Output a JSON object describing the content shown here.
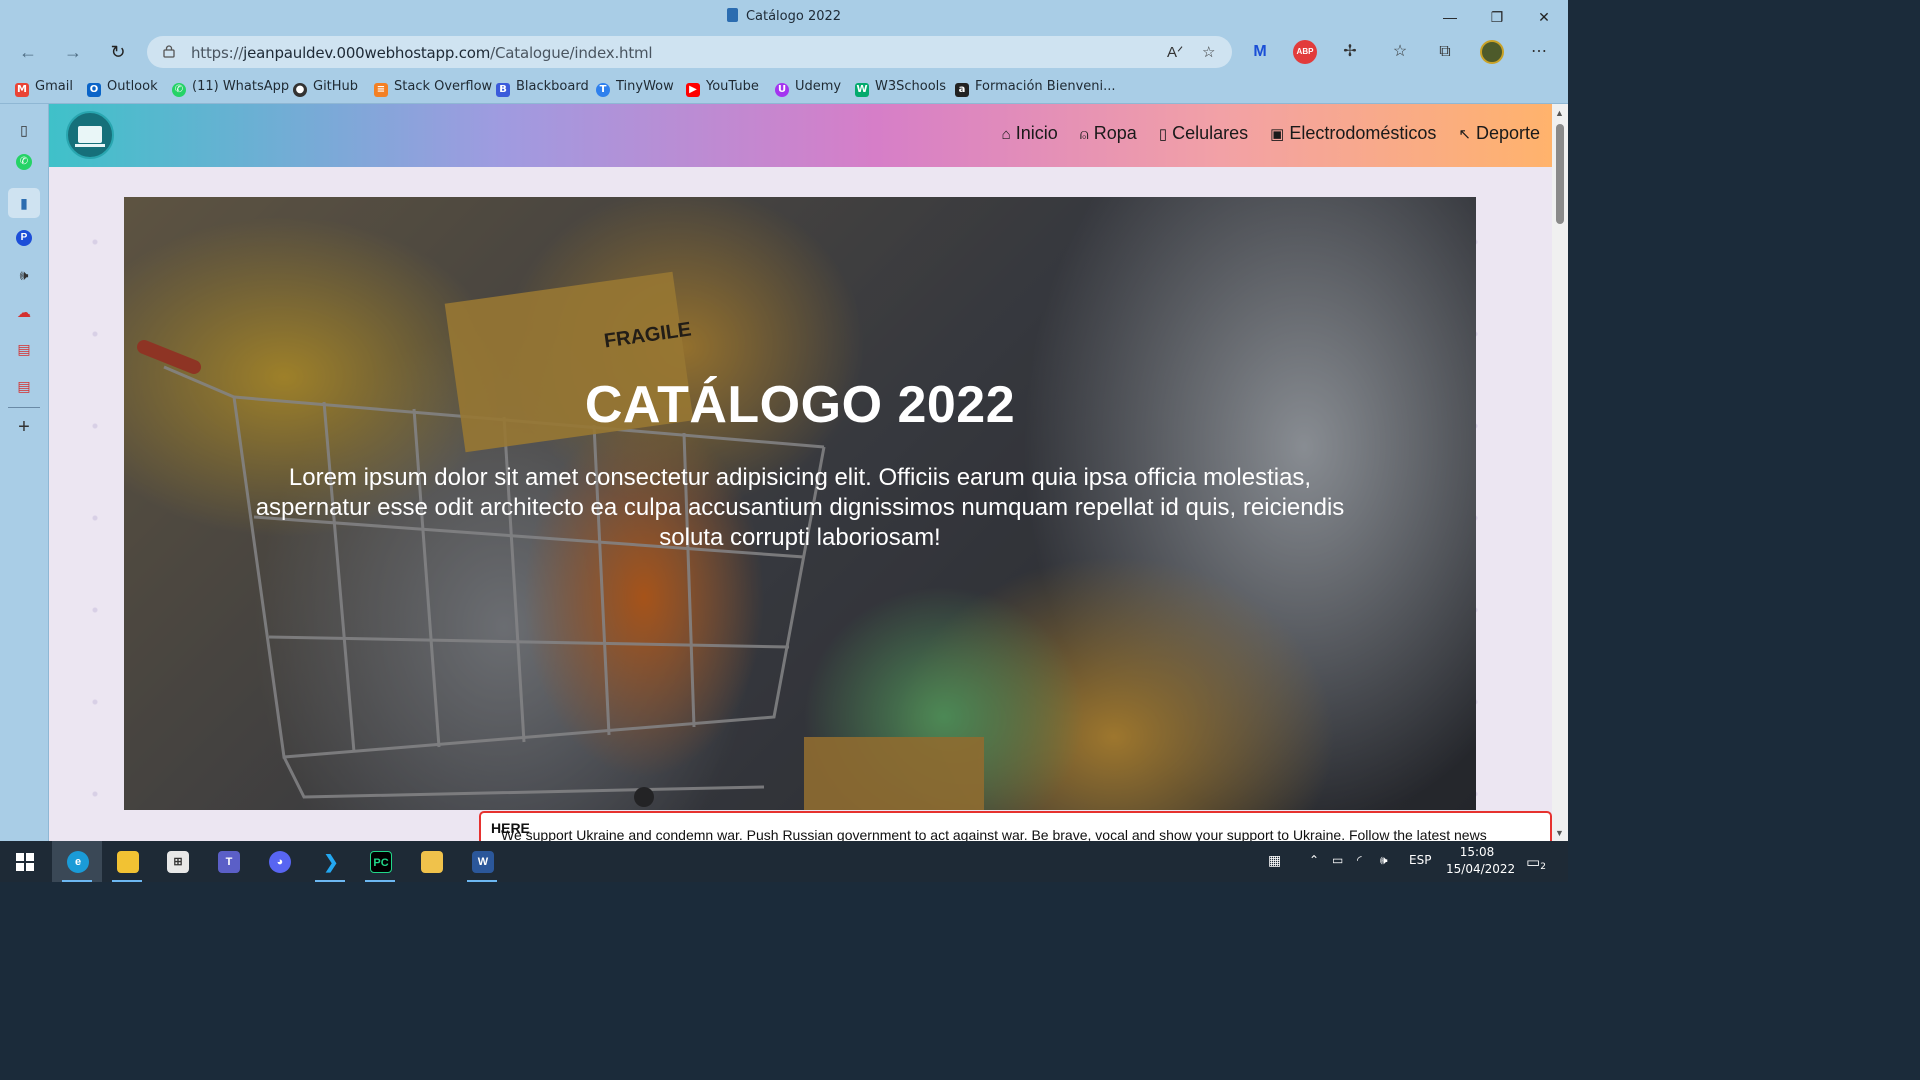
{
  "browser": {
    "tab_title": "Catálogo 2022",
    "url_prefix": "https://",
    "url_domain": "jeanpauldev.000webhostapp.com",
    "url_path": "/Catalogue/index.html",
    "window_controls": [
      "minimize-icon",
      "restore-icon",
      "close-icon"
    ],
    "toolbar_icons": [
      "read-aloud-icon",
      "add-favorite-icon",
      "malwarebytes-icon",
      "adblock-plus-icon",
      "extensions-icon",
      "favorites-icon",
      "collections-icon",
      "profile-avatar",
      "more-icon"
    ],
    "adblock_label": "ABP"
  },
  "bookmarks": [
    {
      "label": "Gmail",
      "icon": "gmail-icon",
      "color": "#ea4335"
    },
    {
      "label": "Outlook",
      "icon": "outlook-icon",
      "color": "#0a64c8"
    },
    {
      "label": "(11) WhatsApp",
      "icon": "whatsapp-icon",
      "color": "#25d366"
    },
    {
      "label": "GitHub",
      "icon": "github-icon",
      "color": "#333333"
    },
    {
      "label": "Stack Overflow",
      "icon": "stackoverflow-icon",
      "color": "#f48024"
    },
    {
      "label": "Blackboard",
      "icon": "blackboard-icon",
      "color": "#3b5bdb"
    },
    {
      "label": "TinyWow",
      "icon": "tinywow-icon",
      "color": "#2f80ed"
    },
    {
      "label": "YouTube",
      "icon": "youtube-icon",
      "color": "#ff0000"
    },
    {
      "label": "Udemy",
      "icon": "udemy-icon",
      "color": "#a435f0"
    },
    {
      "label": "W3Schools",
      "icon": "w3schools-icon",
      "color": "#04aa6d"
    },
    {
      "label": "Formación Bienveni...",
      "icon": "formacion-icon",
      "color": "#222222"
    }
  ],
  "sidebar_icons": [
    "tab-actions-icon",
    "whatsapp-icon",
    "catalog-tab-icon",
    "pingdom-icon",
    "audio-icon",
    "tool-icon",
    "pdf-icon",
    "pdf-icon-2",
    "add-icon"
  ],
  "site": {
    "nav": [
      {
        "label": "Inicio",
        "icon": "home-icon",
        "glyph": "⌂"
      },
      {
        "label": "Ropa",
        "icon": "person-icon",
        "glyph": "⍝"
      },
      {
        "label": "Celulares",
        "icon": "phone-icon",
        "glyph": "▯"
      },
      {
        "label": "Electrodomésticos",
        "icon": "appliance-icon",
        "glyph": "▣"
      },
      {
        "label": "Deporte",
        "icon": "sport-icon",
        "glyph": "↖"
      }
    ],
    "hero_title": "CATÁLOGO 2022",
    "hero_text": "Lorem ipsum dolor sit amet consectetur adipisicing elit. Officiis earum quia ipsa officia molestias, aspernatur esse odit architecto ea culpa accusantium dignissimos numquam repellat id quis, reiciendis soluta corrupti laboriosam!",
    "box_label": "FRAGILE"
  },
  "banner": {
    "text": "We support Ukraine and condemn war. Push Russian government to act against war. Be brave, vocal and show your support to Ukraine. Follow the latest news ",
    "link": "HERE"
  },
  "taskbar": {
    "apps": [
      "start-icon",
      "edge-icon",
      "file-explorer-icon",
      "store-icon",
      "teams-icon",
      "discord-icon",
      "vscode-icon",
      "pycharm-icon",
      "app-cube-icon",
      "word-icon"
    ],
    "app_labels": {
      "vscode": "",
      "pycharm": "PC",
      "word": "W"
    },
    "language": "ESP",
    "time": "15:08",
    "date": "15/04/2022",
    "notifications": "2"
  }
}
